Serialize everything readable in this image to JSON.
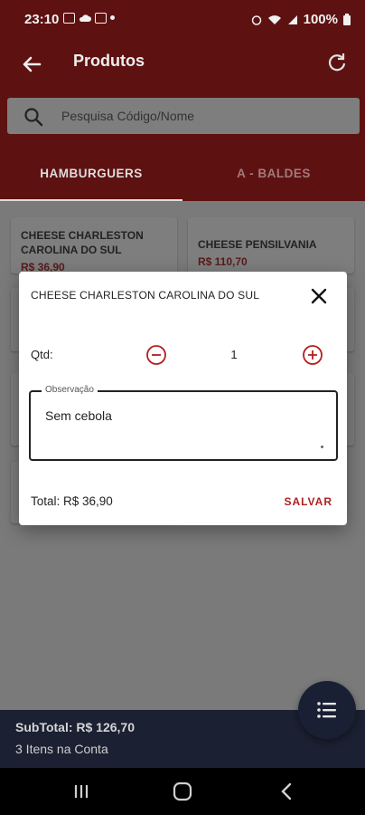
{
  "status_bar": {
    "time": "23:10",
    "battery": "100%"
  },
  "app_bar": {
    "title": "Produtos"
  },
  "search": {
    "placeholder": "Pesquisa Código/Nome"
  },
  "tabs": [
    {
      "label": "HAMBURGUERS",
      "selected": true
    },
    {
      "label": "A - BALDES",
      "selected": false
    }
  ],
  "products": [
    {
      "name_line1": "CHEESE CHARLESTON",
      "name_line2": "CAROLINA DO SUL",
      "price": "R$ 36,90"
    },
    {
      "name_line1": "CHEESE PENSILVANIA",
      "price": "R$ 110,70"
    }
  ],
  "dialog": {
    "title": "CHEESE CHARLESTON CAROLINA DO SUL",
    "qtd_label": "Qtd:",
    "quantity": "1",
    "observation_label": "Observação",
    "observation_value": "Sem cebola",
    "total": "Total: R$ 36,90",
    "save_label": "SALVAR"
  },
  "footer": {
    "subtotal": "SubTotal: R$ 126,70",
    "items": "3 Itens na Conta"
  },
  "colors": {
    "primary": "#8b1a1a",
    "accent": "#b02020",
    "footer": "#1b2032"
  }
}
